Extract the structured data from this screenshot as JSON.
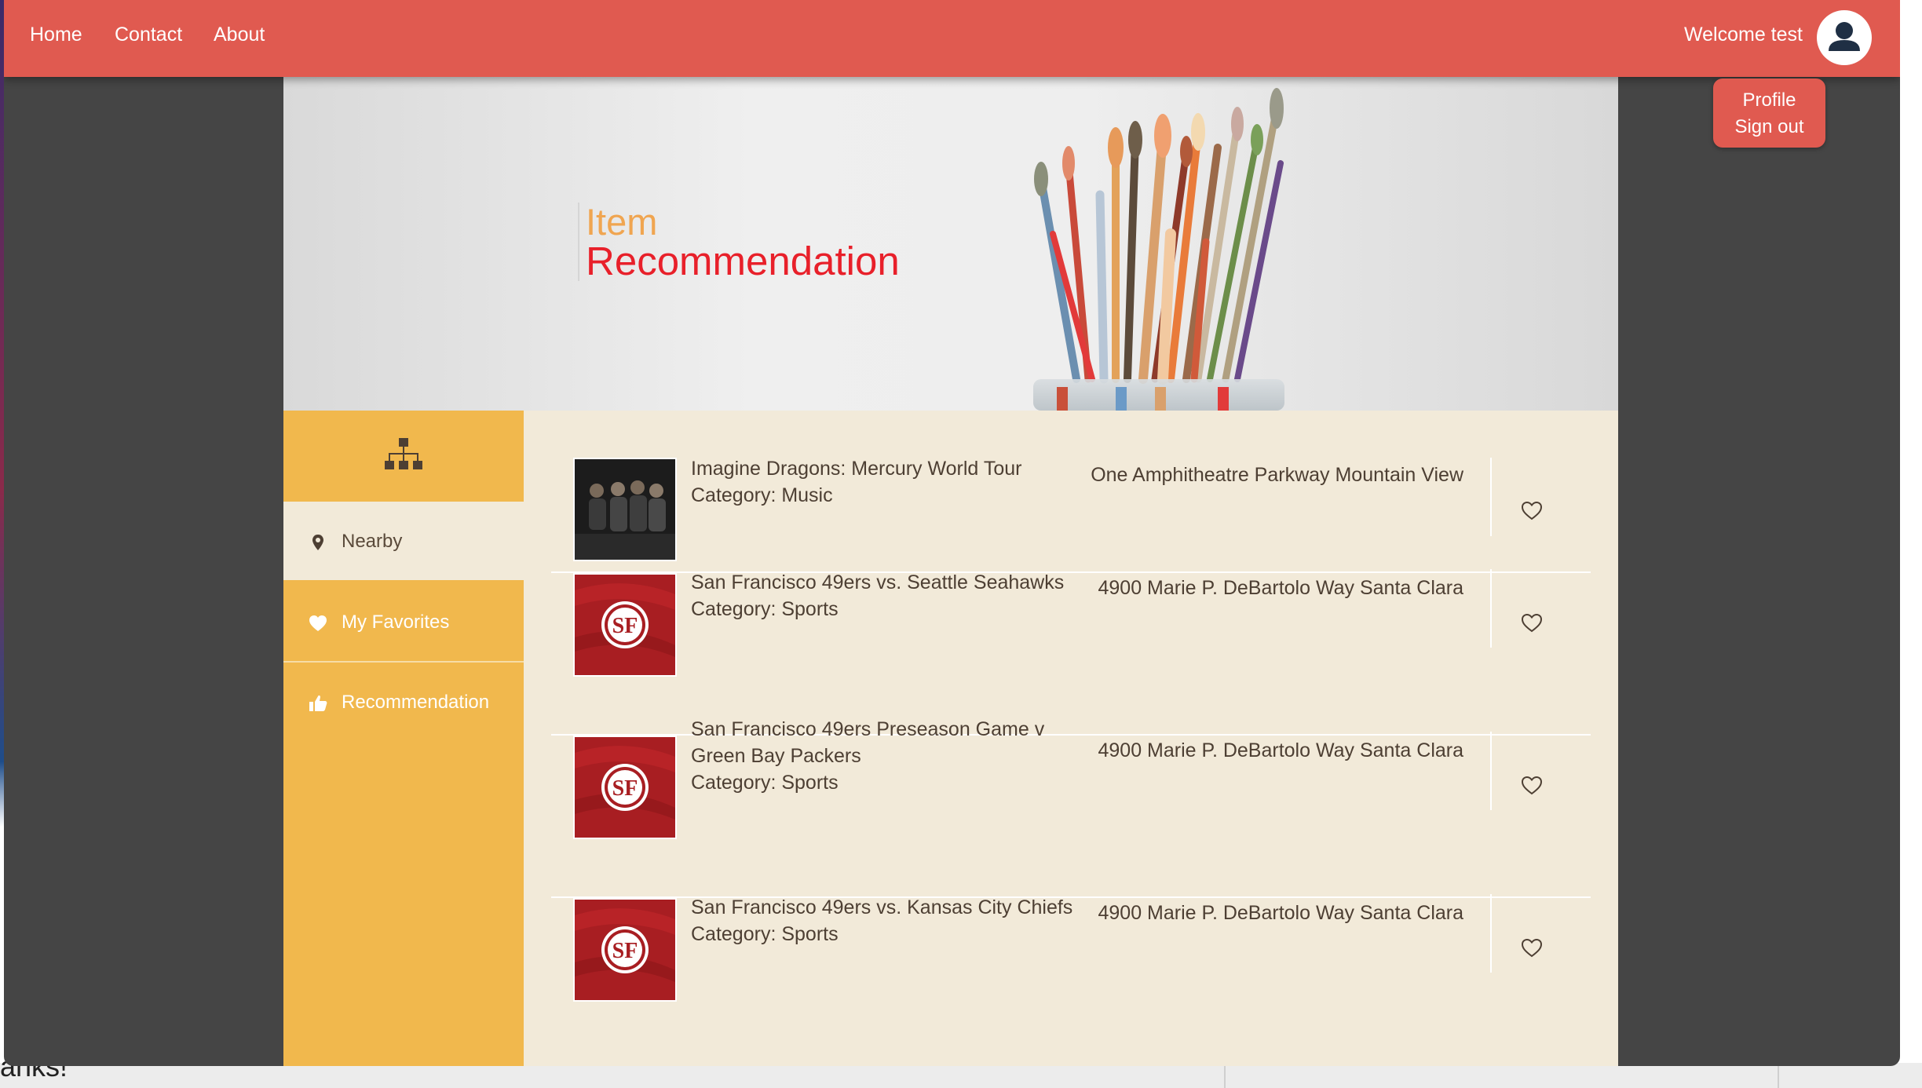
{
  "nav": {
    "links": [
      "Home",
      "Contact",
      "About"
    ],
    "welcome": "Welcome test",
    "dropdown": [
      "Profile",
      "Sign out"
    ]
  },
  "hero": {
    "line1": "Item",
    "line2": "Recommendation"
  },
  "sidebar": {
    "head_icon": "sitemap-icon",
    "items": [
      {
        "label": "Nearby",
        "icon": "map-marker-icon"
      },
      {
        "label": "My Favorites",
        "icon": "heart-icon"
      },
      {
        "label": "Recommendation",
        "icon": "thumbs-up-icon"
      }
    ]
  },
  "items": [
    {
      "title": "Imagine Dragons: Mercury World Tour",
      "category": "Category: Music",
      "address": "One Amphitheatre Parkway Mountain View",
      "image": "band-photo"
    },
    {
      "title": "San Francisco 49ers vs. Seattle Seahawks",
      "category": "Category: Sports",
      "address": "4900 Marie P. DeBartolo Way Santa Clara",
      "image": "49ers-logo"
    },
    {
      "title": "San Francisco 49ers Preseason Game v Green Bay Packers",
      "category": "Category: Sports",
      "address": "4900 Marie P. DeBartolo Way Santa Clara",
      "image": "49ers-logo"
    },
    {
      "title": "San Francisco 49ers vs. Kansas City Chiefs",
      "category": "Category: Sports",
      "address": "4900 Marie P. DeBartolo Way Santa Clara",
      "image": "49ers-logo"
    }
  ],
  "background_text": "anks!",
  "colors": {
    "navbar": "#e05a50",
    "sidebar": "#f1b84d",
    "list_bg": "#f2ead9",
    "hero_orange": "#f0a550",
    "hero_red": "#e8202a"
  }
}
